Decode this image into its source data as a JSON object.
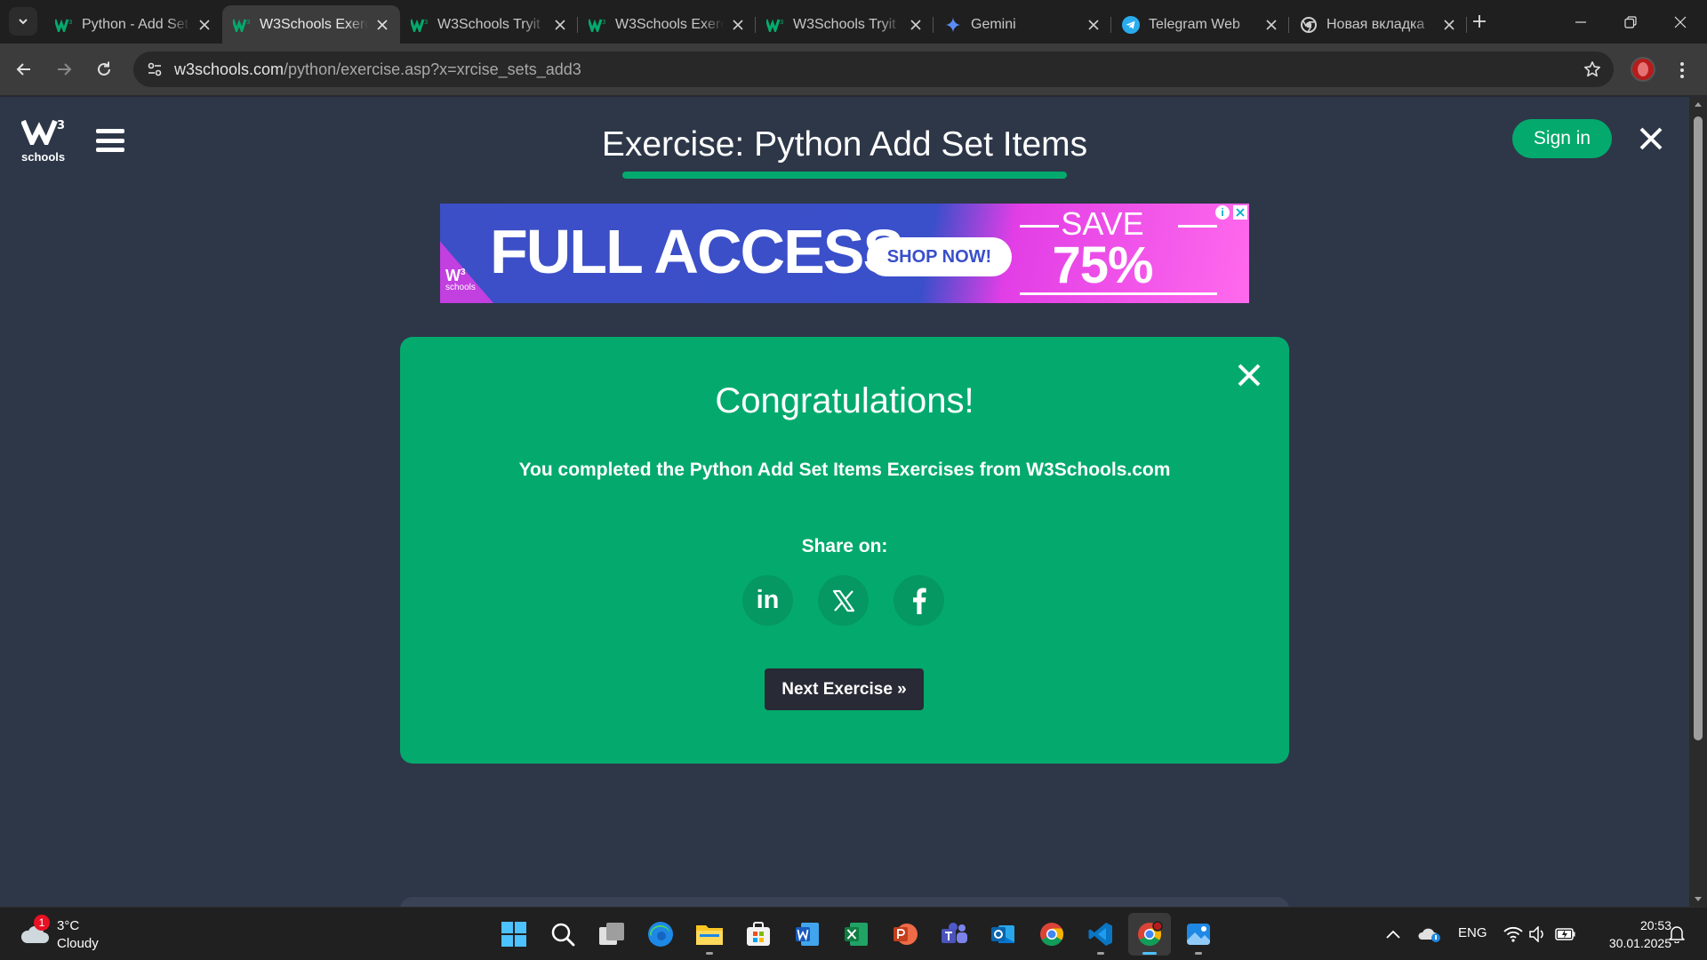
{
  "browser": {
    "tabs": [
      {
        "title": "Python - Add Set Items",
        "icon": "w3schools-icon"
      },
      {
        "title": "W3Schools Exercise",
        "icon": "w3schools-icon",
        "active": true
      },
      {
        "title": "W3Schools Tryit Editor",
        "icon": "w3schools-icon"
      },
      {
        "title": "W3Schools Exercise",
        "icon": "w3schools-icon"
      },
      {
        "title": "W3Schools Tryit Editor",
        "icon": "w3schools-icon"
      },
      {
        "title": "Gemini",
        "icon": "gemini-icon"
      },
      {
        "title": "Telegram Web",
        "icon": "telegram-icon"
      },
      {
        "title": "Новая вкладка",
        "icon": "chrome-icon"
      }
    ],
    "address": {
      "host": "w3schools.com",
      "path": "/python/exercise.asp?x=xrcise_sets_add3"
    }
  },
  "page": {
    "logo_sup": "3",
    "logo_sub": "schools",
    "title": "Exercise: Python Add Set Items",
    "signin_label": "Sign in",
    "accent": "#04aa6d"
  },
  "ad": {
    "headline": "FULL ACCESS",
    "cta": "SHOP NOW!",
    "save": "SAVE",
    "discount": "75% OFF",
    "logo_sup": "3",
    "logo_sub": "schools",
    "info": "i"
  },
  "modal": {
    "title": "Congratulations!",
    "message": "You completed the Python Add Set Items Exercises from W3Schools.com",
    "share_label": "Share on:",
    "share_linkedin": "in",
    "next_label": "Next Exercise »"
  },
  "taskbar": {
    "weather_badge": "1",
    "weather_temp": "3°C",
    "weather_cond": "Cloudy",
    "language": "ENG",
    "time": "20:53",
    "date": "30.01.2025"
  }
}
